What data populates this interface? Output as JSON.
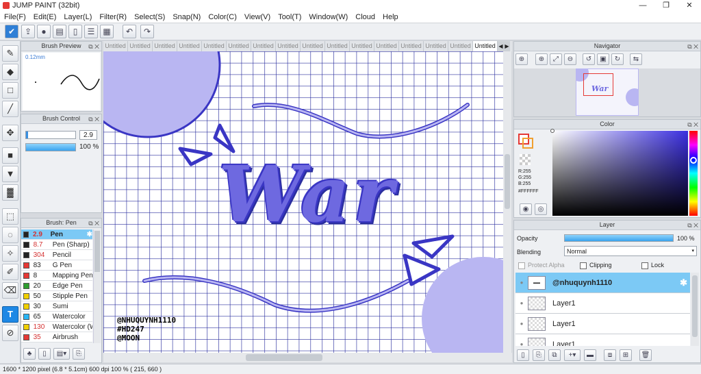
{
  "window": {
    "title": "JUMP PAINT (32bit)",
    "minimize": "—",
    "restore": "❐",
    "close": "✕"
  },
  "menu": [
    "File(F)",
    "Edit(E)",
    "Layer(L)",
    "Filter(R)",
    "Select(S)",
    "Snap(N)",
    "Color(C)",
    "View(V)",
    "Tool(T)",
    "Window(W)",
    "Cloud",
    "Help"
  ],
  "toolbar_icons": [
    "check-icon",
    "upload-icon",
    "comment-icon",
    "chat-icon",
    "document-icon",
    "list-icon",
    "grid-icon",
    "undo-icon",
    "redo-icon"
  ],
  "tools": [
    "pen-icon",
    "eraser-icon",
    "rectangle-icon",
    "line-icon",
    "move-icon",
    "fill-rect-icon",
    "bucket-icon",
    "gradient-icon",
    "select-rect-icon",
    "lasso-icon",
    "magic-wand-icon",
    "select-pen-icon",
    "select-eraser-icon",
    "text-icon",
    "eyedropper-icon"
  ],
  "brush_preview": {
    "title": "Brush Preview",
    "size": "0.12mm"
  },
  "brush_control": {
    "title": "Brush Control",
    "size": "2.9",
    "opacity": "100 %"
  },
  "brush_list": {
    "title": "Brush: Pen",
    "items": [
      {
        "size": "2.9",
        "name": "Pen",
        "color": "#222222"
      },
      {
        "size": "8.7",
        "name": "Pen (Sharp)",
        "color": "#222222"
      },
      {
        "size": "304",
        "name": "Pencil",
        "color": "#222222"
      },
      {
        "size": "83",
        "name": "G Pen",
        "color": "#e53935"
      },
      {
        "size": "8",
        "name": "Mapping Pen",
        "color": "#e53935"
      },
      {
        "size": "20",
        "name": "Edge Pen",
        "color": "#2e9e2e"
      },
      {
        "size": "50",
        "name": "Stipple Pen",
        "color": "#f0d000"
      },
      {
        "size": "30",
        "name": "Sumi",
        "color": "#f0d000"
      },
      {
        "size": "65",
        "name": "Watercolor",
        "color": "#29b6f6"
      },
      {
        "size": "130",
        "name": "Watercolor (W",
        "color": "#f0d000"
      },
      {
        "size": "35",
        "name": "Airbrush",
        "color": "#e53935"
      }
    ]
  },
  "tabs": [
    "Untitled",
    "Untitled",
    "Untitled",
    "Untitled",
    "Untitled",
    "Untitled",
    "Untitled",
    "Untitled",
    "Untitled",
    "Untitled",
    "Untitled",
    "Untitled",
    "Untitled",
    "Untitled",
    "Untitled",
    "Untitled"
  ],
  "canvas": {
    "watermark": [
      "@NHUQUYNH1110",
      "#HD247",
      "@MOON"
    ],
    "lettering": "War",
    "grid_color": "#2b2f9e",
    "accent_color": "#b9b6f2"
  },
  "navigator": {
    "title": "Navigator"
  },
  "color": {
    "title": "Color",
    "r": "R:255",
    "g": "G:255",
    "b": "B:255",
    "hex": "#FFFFFF"
  },
  "layer": {
    "title": "Layer",
    "opacity_label": "Opacity",
    "opacity_value": "100 %",
    "opacity_level": 1.0,
    "blending_label": "Blending",
    "blending_value": "Normal",
    "protect_alpha": "Protect Alpha",
    "clipping": "Clipping",
    "lock": "Lock",
    "items": [
      {
        "name": "@nhuquynh1110"
      },
      {
        "name": "Layer1"
      },
      {
        "name": "Layer1"
      },
      {
        "name": "Layer1"
      }
    ]
  },
  "status": "1600 * 1200 pixel   (6.8 * 5.1cm)   600 dpi   100 %   ( 215, 660 )"
}
